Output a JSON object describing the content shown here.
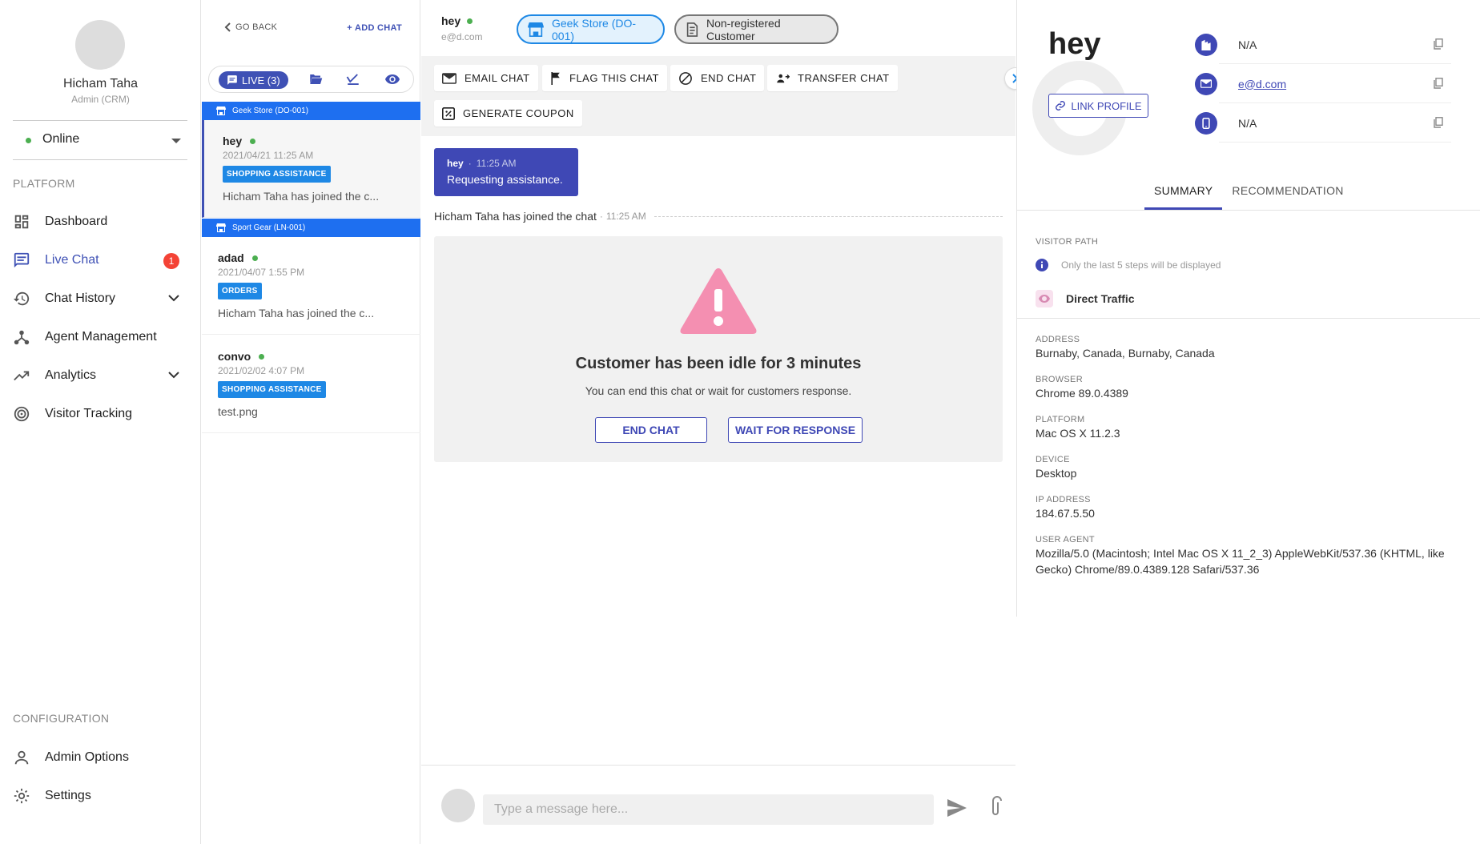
{
  "sidebar": {
    "user_name": "Hicham Taha",
    "user_role": "Admin (CRM)",
    "status": "Online",
    "section_platform": "PLATFORM",
    "section_config": "CONFIGURATION",
    "nav": {
      "dashboard": "Dashboard",
      "live_chat": "Live Chat",
      "live_chat_badge": "1",
      "chat_history": "Chat History",
      "agent_management": "Agent Management",
      "analytics": "Analytics",
      "visitor_tracking": "Visitor Tracking",
      "admin_options": "Admin Options",
      "settings": "Settings"
    },
    "accent_color": "#3f51b5"
  },
  "chatlist": {
    "go_back": "GO BACK",
    "add_chat": "+ ADD CHAT",
    "live_tab": "LIVE (3)",
    "groups": [
      {
        "title": "Geek Store (DO-001)"
      },
      {
        "title": "Sport Gear (LN-001)"
      }
    ],
    "chats": [
      {
        "name": "hey",
        "time": "2021/04/21 11:25 AM",
        "tag": "SHOPPING ASSISTANCE",
        "preview": "Hicham Taha has joined the c..."
      },
      {
        "name": "adad",
        "time": "2021/04/07 1:55 PM",
        "tag": "ORDERS",
        "preview": "Hicham Taha has joined the c..."
      },
      {
        "name": "convo",
        "time": "2021/02/02 4:07 PM",
        "tag": "SHOPPING ASSISTANCE",
        "preview": "test.png"
      }
    ]
  },
  "conversation": {
    "name": "hey",
    "email": "e@d.com",
    "store_chip": "Geek Store (DO-001)",
    "customer_chip": "Non-registered Customer",
    "actions": {
      "email_chat": "EMAIL CHAT",
      "flag_chat": "FLAG THIS CHAT",
      "end_chat": "END CHAT",
      "transfer_chat": "TRANSFER CHAT",
      "generate_coupon": "GENERATE COUPON"
    },
    "message": {
      "sender": "hey",
      "separator": "·",
      "time": "11:25 AM",
      "text": "Requesting assistance."
    },
    "joined": {
      "text": "Hicham Taha has joined the chat",
      "separator": "·",
      "time": "11:25 AM"
    },
    "idle": {
      "title": "Customer has been idle for 3 minutes",
      "subtitle": "You can end this chat or wait for customers response.",
      "end_button": "END CHAT",
      "wait_button": "WAIT FOR RESPONSE"
    },
    "input_placeholder": "Type a message here..."
  },
  "profile": {
    "name": "hey",
    "link_profile": "LINK PROFILE",
    "company": "N/A",
    "email": "e@d.com",
    "phone": "N/A",
    "tabs": {
      "summary": "SUMMARY",
      "recommendation": "RECOMMENDATION"
    },
    "visitor_path": {
      "label": "VISITOR PATH",
      "note": "Only the last 5 steps will be displayed",
      "step": "Direct Traffic"
    },
    "fields": [
      {
        "label": "ADDRESS",
        "value": "Burnaby, Canada, Burnaby, Canada"
      },
      {
        "label": "BROWSER",
        "value": "Chrome 89.0.4389"
      },
      {
        "label": "PLATFORM",
        "value": "Mac OS X 11.2.3"
      },
      {
        "label": "DEVICE",
        "value": "Desktop"
      },
      {
        "label": "IP ADDRESS",
        "value": "184.67.5.50"
      },
      {
        "label": "USER AGENT",
        "value": "Mozilla/5.0 (Macintosh; Intel Mac OS X 11_2_3) AppleWebKit/537.36 (KHTML, like Gecko) Chrome/89.0.4389.128 Safari/537.36"
      }
    ]
  }
}
